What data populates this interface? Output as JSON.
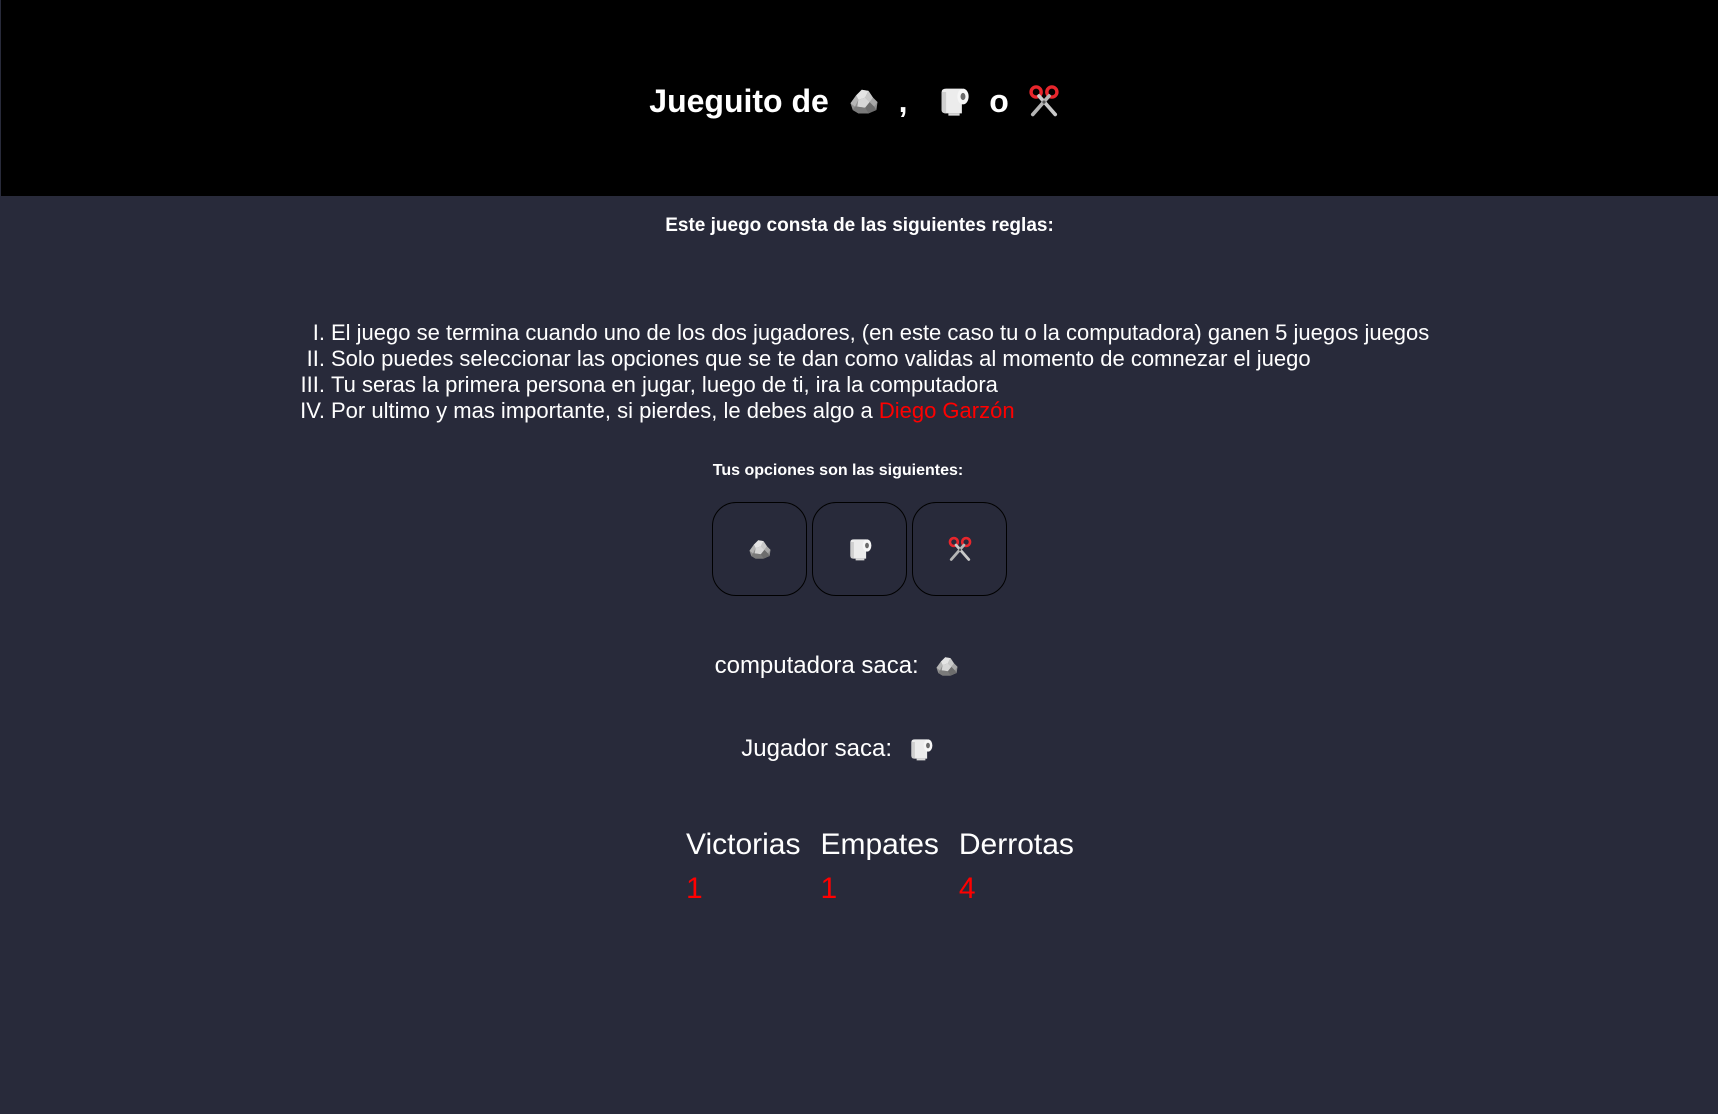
{
  "header": {
    "title_prefix": "Jueguito de",
    "title_comma": ",",
    "title_o": "o"
  },
  "icons": {
    "rock": "rock-icon",
    "paper": "toilet-paper-icon",
    "scissors": "scissors-icon"
  },
  "rules": {
    "heading": "Este juego consta de las siguientes reglas:",
    "items": [
      {
        "num": "I.",
        "text": "El juego se termina cuando uno de los dos jugadores, (en este caso tu o la computadora) ganen 5 juegos juegos"
      },
      {
        "num": "II.",
        "text": "Solo puedes seleccionar las opciones que se te dan como validas al momento de comnezar el juego"
      },
      {
        "num": "III.",
        "text": "Tu seras la primera persona en jugar, luego de ti, ira la computadora"
      },
      {
        "num": "IV.",
        "text": "Por ultimo y mas importante, si pierdes, le debes algo a ",
        "link": "Diego Garzón"
      }
    ]
  },
  "options": {
    "heading": "Tus opciones son las siguientes:"
  },
  "results": {
    "computer_label": "computadora saca:",
    "computer_choice": "rock",
    "player_label": "Jugador saca:",
    "player_choice": "paper"
  },
  "score": {
    "wins_label": "Victorias",
    "wins": "1",
    "draws_label": "Empates",
    "draws": "1",
    "losses_label": "Derrotas",
    "losses": "4"
  },
  "colors": {
    "header_bg": "#000000",
    "page_bg": "#282a3a",
    "accent": "#ff0000",
    "text": "#ffffff"
  }
}
